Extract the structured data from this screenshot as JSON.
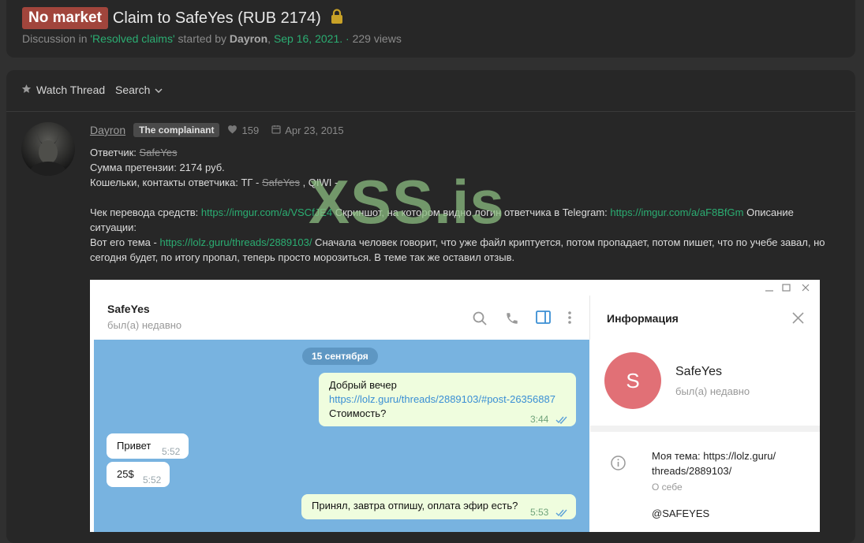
{
  "thread": {
    "prefix": "No market",
    "title": "Claim to SafeYes (RUB 2174)",
    "meta_discussion": "Discussion in ",
    "meta_forum": "'Resolved claims'",
    "meta_started": " started by ",
    "meta_author": "Dayron",
    "meta_sep": ", ",
    "meta_date": "Sep 16, 2021",
    "meta_dot": ". · ",
    "meta_views": "229 views"
  },
  "toolbar": {
    "watch": "Watch Thread",
    "search": "Search"
  },
  "post": {
    "username": "Dayron",
    "role": "The complainant",
    "likes": "159",
    "joined": "Apr 23, 2015",
    "l1_label": "Ответчик: ",
    "l1_value": "SafeYes",
    "l2": "Сумма претензии: 2174 руб.",
    "l3_a": "Кошельки, контакты ответчика: ТГ - ",
    "l3_value": "SafeYes",
    "l3_b": " , QIWI -",
    "p2_a": "Чек перевода средств: ",
    "p2_link1": "https://imgur.com/a/VSCfJE4",
    "p2_b": " Скриншот, на котором видно логин ответчика в Telegram: ",
    "p2_link2": "https://imgur.com/a/aF8BfGm",
    "p2_c": " Описание ситуации:",
    "p3_a": "Вот его тема - ",
    "p3_link": "https://lolz.guru/threads/2889103/",
    "p3_b": " Сначала человек говорит, что уже файл криптуется, потом пропадает, потом пишет, что по учебе завал, но сегодня будет, по итогу пропал, теперь просто морозиться. В теме так же оставил отзыв."
  },
  "watermark": "XSS.is",
  "telegram": {
    "chat_name": "SafeYes",
    "chat_status": "был(а) недавно",
    "date": "15 сентября",
    "msg1_line1": "Добрый вечер",
    "msg1_link": "https://lolz.guru/threads/2889103/#post-26356887",
    "msg1_line3": "Стоимость?",
    "msg1_time": "3:44",
    "msg2": "Привет",
    "msg2_time": "5:52",
    "msg3": "25$",
    "msg3_time": "5:52",
    "msg4": "Принял, завтра отпишу, оплата эфир есть?",
    "msg4_time": "5:53",
    "info_title": "Информация",
    "profile_initial": "S",
    "profile_name": "SafeYes",
    "profile_status": "был(а) недавно",
    "bio": "Моя тема: https://lolz.guru/ threads/2889103/",
    "bio_label": "О себе",
    "username": "@SAFEYES"
  },
  "colors": {
    "prefix_bg": "#a1453c",
    "link_green": "#2bad72",
    "avatar_red": "#e17076",
    "chat_bg": "#78b3e0"
  }
}
